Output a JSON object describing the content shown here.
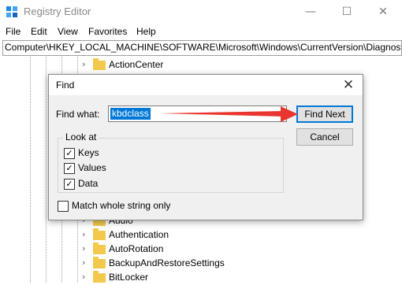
{
  "window": {
    "title": "Registry Editor",
    "min_glyph": "—",
    "max_glyph": "☐",
    "close_glyph": "✕"
  },
  "menu": [
    "File",
    "Edit",
    "View",
    "Favorites",
    "Help"
  ],
  "address": "Computer\\HKEY_LOCAL_MACHINE\\SOFTWARE\\Microsoft\\Windows\\CurrentVersion\\Diagnosti",
  "tree": {
    "chevron": "›",
    "items": [
      "ActionCenter",
      "Audio",
      "Authentication",
      "AutoRotation",
      "BackupAndRestoreSettings",
      "BitLocker"
    ]
  },
  "find_dialog": {
    "title": "Find",
    "close_glyph": "✕",
    "find_what_label": "Find what:",
    "find_what_value": "kbdclass",
    "find_next_label": "Find Next",
    "cancel_label": "Cancel",
    "look_at_label": "Look at",
    "checkboxes": [
      {
        "label": "Keys",
        "checked": true
      },
      {
        "label": "Values",
        "checked": true
      },
      {
        "label": "Data",
        "checked": true
      }
    ],
    "match_whole": {
      "label": "Match whole string only",
      "checked": false
    },
    "check_glyph": "✓"
  },
  "annotation": {
    "arrow_color": "#e8362e"
  },
  "colors": {
    "selection": "#0078d7",
    "folder": "#f2c94c"
  }
}
